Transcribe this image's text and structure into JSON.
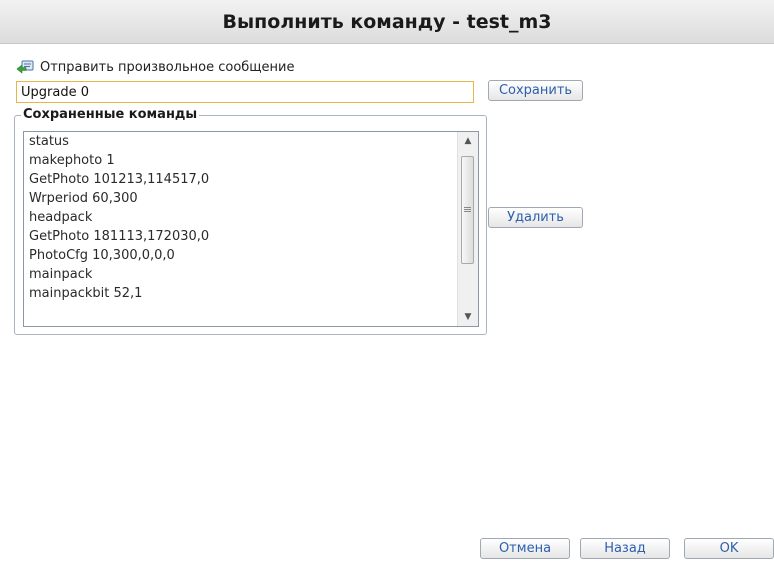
{
  "window": {
    "title": "Выполнить команду - test_m3"
  },
  "send": {
    "icon": "send-message-icon",
    "label": "Отправить произвольное сообщение",
    "input_value": "Upgrade 0"
  },
  "buttons": {
    "save": "Сохранить",
    "delete": "Удалить",
    "cancel": "Отмена",
    "back": "Назад",
    "ok": "OK"
  },
  "saved_commands": {
    "legend": "Сохраненные команды",
    "items": [
      "status",
      "makephoto 1",
      "GetPhoto 101213,114517,0",
      "Wrperiod 60,300",
      "headpack",
      "GetPhoto 181113,172030,0",
      "PhotoCfg 10,300,0,0,0",
      "mainpack",
      "mainpackbit 52,1"
    ]
  },
  "colors": {
    "button_text": "#2b5fae",
    "input_border_focus": "#e8b54a"
  }
}
